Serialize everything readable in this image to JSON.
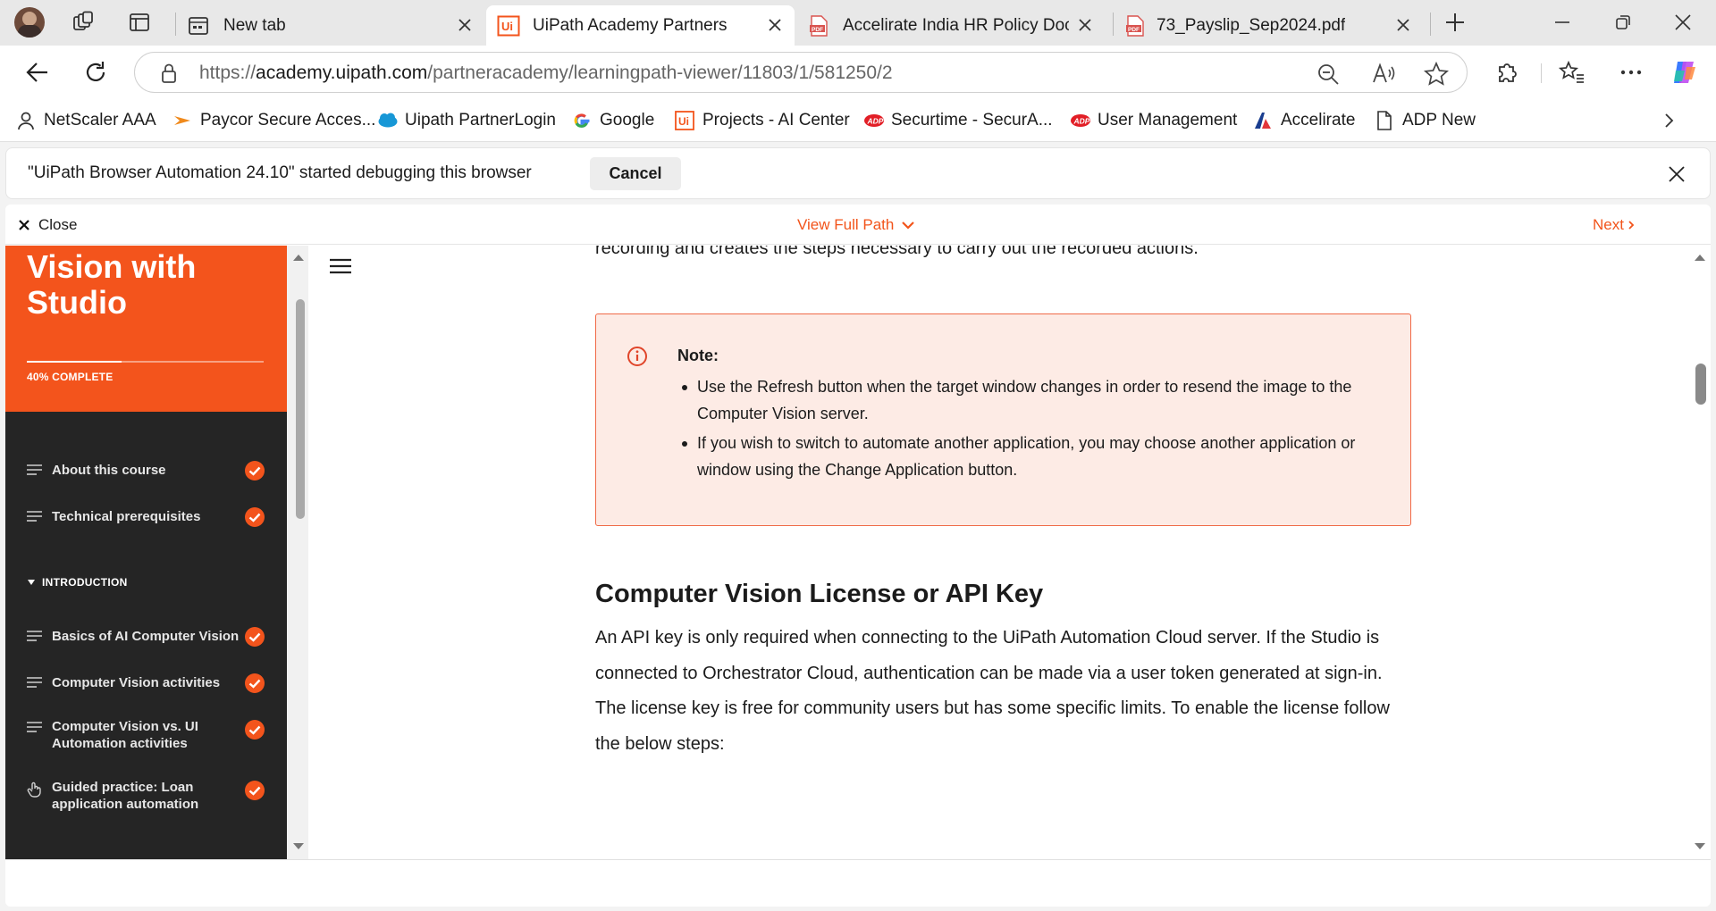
{
  "tabs": [
    {
      "title": "New tab"
    },
    {
      "title": "UiPath Academy Partners"
    },
    {
      "title": "Accelirate India HR Policy Docum"
    },
    {
      "title": "73_Payslip_Sep2024.pdf"
    }
  ],
  "address": {
    "prefix": "https://",
    "host": "academy.uipath.com",
    "path": "/partneracademy/learningpath-viewer/11803/1/581250/2"
  },
  "favorites": [
    {
      "label": "NetScaler AAA",
      "icon": "person-icon"
    },
    {
      "label": "Paycor Secure Acces...",
      "icon": "paycor-icon"
    },
    {
      "label": "Uipath PartnerLogin",
      "icon": "salesforce-cloud-icon"
    },
    {
      "label": "Google",
      "icon": "google-icon"
    },
    {
      "label": "Projects - AI Center",
      "icon": "uipath-icon"
    },
    {
      "label": "Securtime - SecurA...",
      "icon": "adp-icon"
    },
    {
      "label": "User Management",
      "icon": "adp-icon"
    },
    {
      "label": "Accelirate",
      "icon": "accelirate-icon"
    },
    {
      "label": "ADP New",
      "icon": "page-icon"
    }
  ],
  "infobar": {
    "message": "\"UiPath Browser Automation 24.10\" started debugging this browser",
    "cancel_label": "Cancel"
  },
  "viewer": {
    "close_label": "Close",
    "view_path_label": "View Full Path",
    "next_label": "Next"
  },
  "sidebar": {
    "course_title": "Vision with Studio",
    "progress_fraction": 0.4,
    "progress_label": "40% COMPLETE",
    "section_label": "INTRODUCTION",
    "lessons_before": [
      {
        "label": "About this course",
        "completed": true
      },
      {
        "label": "Technical prerequisites",
        "completed": true
      }
    ],
    "lessons_after": [
      {
        "label": "Basics of AI Computer Vision",
        "completed": true
      },
      {
        "label": "Computer Vision activities",
        "completed": true
      },
      {
        "label": "Computer Vision vs. UI Automation activities",
        "completed": true
      },
      {
        "label": "Guided practice: Loan application automation",
        "completed": true
      }
    ]
  },
  "content": {
    "partial_line": "recording and creates the steps necessary to carry out the recorded actions.",
    "note": {
      "title": "Note:",
      "bullets": [
        "Use the Refresh button when the target window changes in order to resend the image to the Computer Vision server.",
        "If you wish to switch to automate another application, you may choose another application or window using the Change Application button."
      ]
    },
    "section_title": "Computer Vision License or API Key",
    "section_body": "An API key is only required when connecting to the UiPath Automation Cloud server. If the Studio is connected to Orchestrator Cloud, authentication can be made via a user token generated at sign-in. The license key is free for community users but has some specific limits. To enable the license follow the below steps:"
  },
  "colors": {
    "accent": "#f3541c",
    "sidebar_bg": "#252525",
    "note_bg": "#fdebe5",
    "note_border": "#f06a47"
  }
}
